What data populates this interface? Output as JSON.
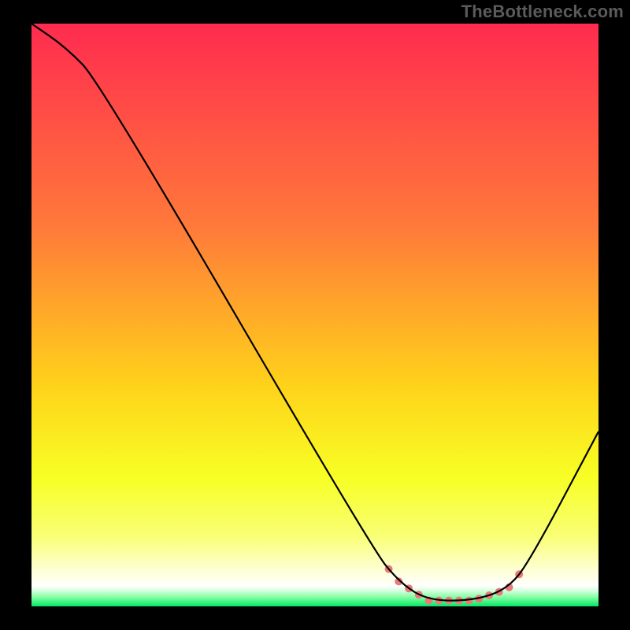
{
  "watermark": "TheBottleneck.com",
  "chart_data": {
    "type": "line",
    "title": "",
    "xlabel": "",
    "ylabel": "",
    "xlim": [
      0,
      100
    ],
    "ylim": [
      0,
      100
    ],
    "grid": false,
    "legend": false,
    "gradient_stops": [
      {
        "offset": 0.0,
        "color": "#ff2b4f"
      },
      {
        "offset": 0.35,
        "color": "#ff7a3a"
      },
      {
        "offset": 0.62,
        "color": "#ffd21a"
      },
      {
        "offset": 0.78,
        "color": "#f7ff25"
      },
      {
        "offset": 0.88,
        "color": "#f9ff75"
      },
      {
        "offset": 0.93,
        "color": "#fdffc8"
      },
      {
        "offset": 0.965,
        "color": "#ffffff"
      },
      {
        "offset": 0.975,
        "color": "#c9ffd6"
      },
      {
        "offset": 0.985,
        "color": "#7cff9e"
      },
      {
        "offset": 1.0,
        "color": "#00e865"
      }
    ],
    "series": [
      {
        "name": "bottleneck-curve",
        "stroke": "#000000",
        "x": [
          0,
          6,
          12,
          60,
          65,
          70,
          78,
          84,
          88,
          100
        ],
        "values": [
          100,
          96,
          90,
          10,
          4,
          1,
          1,
          3,
          8,
          30
        ]
      }
    ],
    "flat_region": {
      "x_start": 63,
      "x_end": 86,
      "marker_color": "#e97a7a",
      "marker_radius_px": 5,
      "marker_count": 14
    }
  }
}
